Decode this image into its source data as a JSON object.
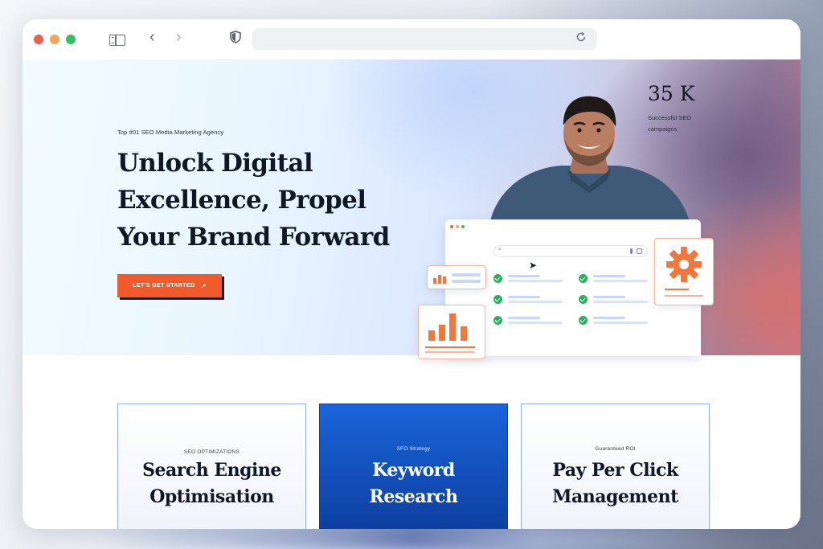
{
  "browser": {
    "address_value": "",
    "icons": [
      "sidebar-icon",
      "back-icon",
      "forward-icon",
      "shield-icon",
      "reload-icon"
    ]
  },
  "hero": {
    "eyebrow": "Top #01 SEO Media Marketing Agency",
    "title_lines": [
      "Unlock Digital",
      "Excellence, Propel",
      "Your Brand Forward"
    ],
    "cta_label": "LET'S GET STARTED",
    "cta_icon": "↗",
    "stat": {
      "value": "35 K",
      "label": "Successful SEO campaigns"
    }
  },
  "services": [
    {
      "kicker": "SEO OPTIMIZATIONS",
      "title_lines": [
        "Search Engine",
        "Optimisation"
      ]
    },
    {
      "kicker": "SFO Strategy",
      "title_lines": [
        "Keyword",
        "Research"
      ]
    },
    {
      "kicker": "Guaranteed ROI",
      "title_lines": [
        "Pay Per Click",
        "Management"
      ]
    }
  ],
  "colors": {
    "accent": "#f15a2b",
    "brand_blue": "#1a64da",
    "heading": "#101827",
    "check_green": "#27b35b"
  }
}
